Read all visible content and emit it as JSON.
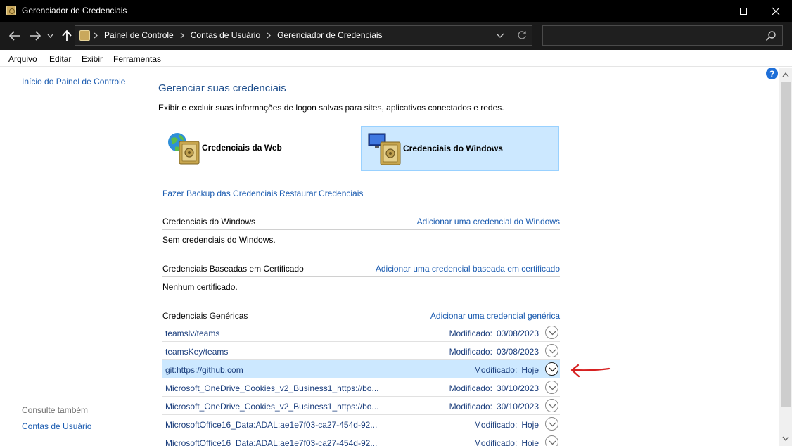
{
  "window": {
    "title": "Gerenciador de Credenciais"
  },
  "address_bar": {
    "crumbs": [
      "Painel de Controle",
      "Contas de Usuário",
      "Gerenciador de Credenciais"
    ]
  },
  "search": {
    "placeholder": ""
  },
  "menu": {
    "items": [
      "Arquivo",
      "Editar",
      "Exibir",
      "Ferramentas"
    ]
  },
  "left_pane": {
    "home_link": "Início do Painel de Controle",
    "see_also_label": "Consulte também",
    "see_also_link": "Contas de Usuário"
  },
  "main": {
    "heading": "Gerenciar suas credenciais",
    "subtitle": "Exibir e excluir suas informações de logon salvas para sites, aplicativos conectados e redes.",
    "tiles": {
      "web": "Credenciais da Web",
      "windows": "Credenciais do Windows"
    },
    "backup_link": "Fazer Backup das Credenciais",
    "restore_link": "Restaurar Credenciais",
    "sections": {
      "windows": {
        "title": "Credenciais do Windows",
        "add_link": "Adicionar uma credencial do Windows",
        "empty": "Sem credenciais do Windows."
      },
      "certificate": {
        "title": "Credenciais Baseadas em Certificado",
        "add_link": "Adicionar uma credencial baseada em certificado",
        "empty": "Nenhum certificado."
      },
      "generic": {
        "title": "Credenciais Genéricas",
        "add_link": "Adicionar uma credencial genérica",
        "modified_label": "Modificado:",
        "items": [
          {
            "name": "teamslv/teams",
            "date": "03/08/2023",
            "selected": false
          },
          {
            "name": "teamsKey/teams",
            "date": "03/08/2023",
            "selected": false
          },
          {
            "name": "git:https://github.com",
            "date": "Hoje",
            "selected": true
          },
          {
            "name": "Microsoft_OneDrive_Cookies_v2_Business1_https://bo...",
            "date": "30/10/2023",
            "selected": false
          },
          {
            "name": "Microsoft_OneDrive_Cookies_v2_Business1_https://bo...",
            "date": "30/10/2023",
            "selected": false
          },
          {
            "name": "MicrosoftOffice16_Data:ADAL:ae1e7f03-ca27-454d-92...",
            "date": "Hoje",
            "selected": false
          },
          {
            "name": "MicrosoftOffice16_Data:ADAL:ae1e7f03-ca27-454d-92...",
            "date": "Hoje",
            "selected": false
          }
        ]
      }
    }
  },
  "colors": {
    "link": "#1a5bb0",
    "selection": "#cce8ff",
    "annotation_arrow": "#d62020"
  }
}
